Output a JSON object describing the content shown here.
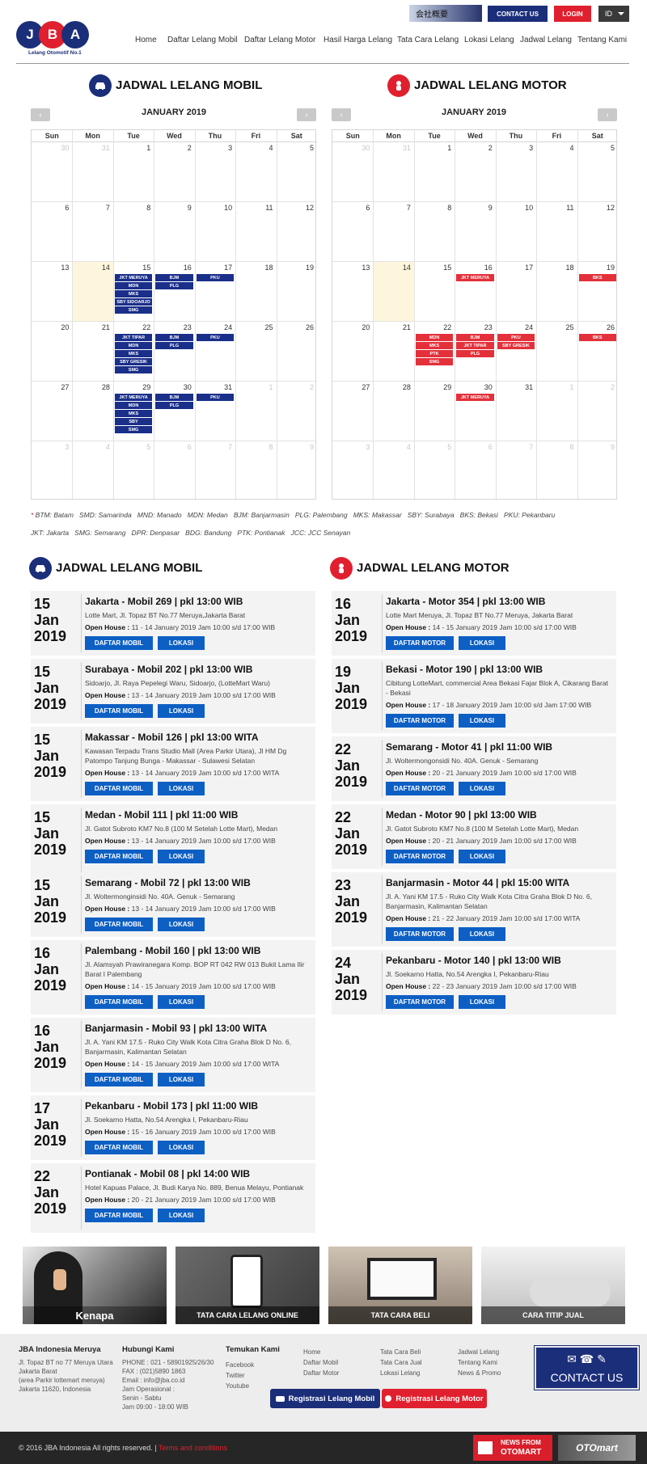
{
  "header": {
    "logo_letters": [
      "J",
      "B",
      "A"
    ],
    "tagline": "Lelang Otomotif No.1",
    "top_banner": "会社概要",
    "contact_btn": "CONTACT US",
    "login_btn": "LOGIN",
    "lang": "ID",
    "nav": [
      "Home",
      "Daftar Lelang Mobil",
      "Daftar Lelang Motor",
      "Hasil Harga Lelang",
      "Tata Cara Lelang",
      "Lokasi Lelang",
      "Jadwal Lelang",
      "Tentang Kami"
    ]
  },
  "calendar_mobil": {
    "title": "JADWAL LELANG MOBIL",
    "month": "JANUARY 2019",
    "days": [
      "Sun",
      "Mon",
      "Tue",
      "Wed",
      "Thu",
      "Fri",
      "Sat"
    ],
    "weeks": [
      [
        "30",
        "31",
        "1",
        "2",
        "3",
        "4",
        "5"
      ],
      [
        "6",
        "7",
        "8",
        "9",
        "10",
        "11",
        "12"
      ],
      [
        "13",
        "14",
        "15",
        "16",
        "17",
        "18",
        "19"
      ],
      [
        "20",
        "21",
        "22",
        "23",
        "24",
        "25",
        "26"
      ],
      [
        "27",
        "28",
        "29",
        "30",
        "31",
        "1",
        "2"
      ],
      [
        "3",
        "4",
        "5",
        "6",
        "7",
        "8",
        "9"
      ]
    ],
    "events": {
      "w2d2": [
        "JKT MERUYA",
        "MDN",
        "MKS",
        "SBY SIDOARJO",
        "SMG"
      ],
      "w2d3": [
        "BJM",
        "PLG"
      ],
      "w2d4": [
        "PKU"
      ],
      "w3d2": [
        "JKT TIPAR",
        "MDN",
        "MKS",
        "SBY GRESIK",
        "SMG"
      ],
      "w3d3": [
        "BJM",
        "PLG"
      ],
      "w3d4": [
        "PKU"
      ],
      "w4d2": [
        "JKT MERUYA",
        "MDN",
        "MKS",
        "SBY",
        "SMG"
      ],
      "w4d3": [
        "BJM",
        "PLG"
      ],
      "w4d4": [
        "PKU"
      ]
    }
  },
  "calendar_motor": {
    "title": "JADWAL LELANG MOTOR",
    "month": "JANUARY 2019",
    "days": [
      "Sun",
      "Mon",
      "Tue",
      "Wed",
      "Thu",
      "Fri",
      "Sat"
    ],
    "weeks": [
      [
        "30",
        "31",
        "1",
        "2",
        "3",
        "4",
        "5"
      ],
      [
        "6",
        "7",
        "8",
        "9",
        "10",
        "11",
        "12"
      ],
      [
        "13",
        "14",
        "15",
        "16",
        "17",
        "18",
        "19"
      ],
      [
        "20",
        "21",
        "22",
        "23",
        "24",
        "25",
        "26"
      ],
      [
        "27",
        "28",
        "29",
        "30",
        "31",
        "1",
        "2"
      ],
      [
        "3",
        "4",
        "5",
        "6",
        "7",
        "8",
        "9"
      ]
    ],
    "events": {
      "w2d3": [
        "JKT MERUYA"
      ],
      "w2d6": [
        "BKS"
      ],
      "w3d2": [
        "MDN",
        "MKS",
        "PTK",
        "SMG"
      ],
      "w3d3": [
        "BJM",
        "JKT TIPAR",
        "PLG"
      ],
      "w3d4": [
        "PKU",
        "SBY GRESIK"
      ],
      "w3d6": [
        "BKS"
      ],
      "w4d3": [
        "JKT MERUYA"
      ]
    }
  },
  "legend": {
    "line1": "BTM: Batam   SMD: Samarinda   MND: Manado   MDN: Medan   BJM: Banjarmasin   PLG: Palembang   MKS: Makassar   SBY: Surabaya   BKS: Bekasi   PKU: Pekanbaru",
    "line2": "JKT: Jakarta   SMG: Semarang   DPR: Denpasar   BDG: Bandung   PTK: Pontianak   JCC: JCC Senayan"
  },
  "list_mobil": {
    "title": "JADWAL LELANG MOBIL",
    "btn1": "DAFTAR MOBIL",
    "btn2": "LOKASI",
    "items": [
      {
        "d": "15",
        "m": "Jan",
        "y": "2019",
        "title": "Jakarta - Mobil 269 | pkl 13:00 WIB",
        "addr": "Lotte Mart, Jl. Topaz BT No.77 Meruya,Jakarta Barat",
        "oh": "11 - 14 January 2019 Jam 10:00 s/d 17:00 WIB"
      },
      {
        "d": "15",
        "m": "Jan",
        "y": "2019",
        "title": "Surabaya - Mobil 202 | pkl 13:00 WIB",
        "addr": "Sidoarjo, Jl. Raya Pepelegi Waru, Sidoarjo, (LotteMart Waru)",
        "oh": "13 - 14 January 2019 Jam 10:00 s/d 17:00 WIB"
      },
      {
        "d": "15",
        "m": "Jan",
        "y": "2019",
        "title": "Makassar - Mobil 126 | pkl 13:00 WITA",
        "addr": "Kawasan Terpadu Trans Studio Mall (Area Parkir Utara), Jl HM Dg Patompo Tanjung Bunga - Makassar - Sulawesi Selatan",
        "oh": "13 - 14 January 2019 Jam 10:00 s/d 17:00 WITA"
      },
      {
        "d": "15",
        "m": "Jan",
        "y": "2019",
        "title": "Medan - Mobil 111 | pkl 11:00 WIB",
        "addr": "Jl. Gatot Subroto KM7 No.8 (100 M Setelah Lotte Mart), Medan",
        "oh": "13 - 14 January 2019 Jam 10:00 s/d 17:00 WIB"
      },
      {
        "d": "15",
        "m": "Jan",
        "y": "2019",
        "title": "Semarang - Mobil 72 | pkl 13:00 WIB",
        "addr": "Jl. Woltermonginsidi No. 40A. Genuk - Semarang",
        "oh": "13 - 14 January 2019 Jam 10:00 s/d 17:00 WIB"
      },
      {
        "d": "16",
        "m": "Jan",
        "y": "2019",
        "title": "Palembang - Mobil 160 | pkl 13:00 WIB",
        "addr": "Jl. Alamsyah Prawiranegara Komp. BOP RT 042 RW 013 Bukit Lama Ilir Barat I Palembang",
        "oh": "14 - 15 January 2019 Jam 10:00 s/d 17:00 WIB"
      },
      {
        "d": "16",
        "m": "Jan",
        "y": "2019",
        "title": "Banjarmasin - Mobil 93 | pkl 13:00 WITA",
        "addr": "Jl. A. Yani KM 17.5 - Ruko City Walk Kota Citra Graha Blok D No. 6, Banjarmasin, Kalimantan Selatan",
        "oh": "14 - 15 January 2019 Jam 10:00 s/d 17:00 WITA"
      },
      {
        "d": "17",
        "m": "Jan",
        "y": "2019",
        "title": "Pekanbaru - Mobil 173 | pkl 11:00 WIB",
        "addr": "Jl. Soekarno Hatta, No.54 Arengka I, Pekanbaru-Riau",
        "oh": "15 - 16 January 2019 Jam 10:00 s/d 17:00 WIB"
      },
      {
        "d": "22",
        "m": "Jan",
        "y": "2019",
        "title": "Pontianak - Mobil 08 | pkl 14:00 WIB",
        "addr": "Hotel Kapuas Palace, Jl. Budi Karya No. 889, Benua Melayu, Pontianak",
        "oh": "20 - 21 January 2019 Jam 10:00 s/d 17:00 WIB"
      }
    ]
  },
  "list_motor": {
    "title": "JADWAL LELANG MOTOR",
    "btn1": "DAFTAR MOTOR",
    "btn2": "LOKASI",
    "items": [
      {
        "d": "16",
        "m": "Jan",
        "y": "2019",
        "title": "Jakarta - Motor 354 | pkl 13:00 WIB",
        "addr": "Lotte Mart Meruya, Jl. Topaz BT No.77 Meruya, Jakarta Barat",
        "oh": "14 - 15 January 2019 Jam 10:00 s/d 17:00 WIB"
      },
      {
        "d": "19",
        "m": "Jan",
        "y": "2019",
        "title": "Bekasi - Motor 190 | pkl 13:00 WIB",
        "addr": "Cibitung LotteMart, commercial Area Bekasi Fajar Blok A, Cikarang Barat - Bekasi",
        "oh": "17 - 18 January 2019 Jam 10:00 s/d Jam 17:00 WIB"
      },
      {
        "d": "22",
        "m": "Jan",
        "y": "2019",
        "title": "Semarang - Motor 41 | pkl 11:00 WIB",
        "addr": "Jl. Woltermongonsidi No. 40A. Genuk - Semarang",
        "oh": "20 - 21 January 2019 Jam 10:00 s/d 17:00 WIB"
      },
      {
        "d": "22",
        "m": "Jan",
        "y": "2019",
        "title": "Medan - Motor 90 | pkl 13:00 WIB",
        "addr": "Jl. Gatot Subroto KM7 No.8 (100 M Setelah Lotte Mart), Medan",
        "oh": "20 - 21 January 2019 Jam 10:00 s/d 17:00 WIB"
      },
      {
        "d": "23",
        "m": "Jan",
        "y": "2019",
        "title": "Banjarmasin - Motor 44 | pkl 15:00 WITA",
        "addr": "Jl. A. Yani KM 17.5 - Ruko City Walk Kota Citra Graha Blok D No. 6, Banjarmasin, Kalimantan Selatan",
        "oh": "21 - 22 January 2019 Jam 10:00 s/d 17:00 WITA"
      },
      {
        "d": "24",
        "m": "Jan",
        "y": "2019",
        "title": "Pekanbaru - Motor 140 | pkl 13:00 WIB",
        "addr": "Jl. Soekarno Hatta, No.54 Arengka I, Pekanbaru-Riau",
        "oh": "22 - 23 January 2019 Jam 10:00 s/d 17:00 WIB"
      }
    ]
  },
  "open_house_label": "Open House :",
  "promos": [
    "Kenapa",
    "TATA CARA LELANG ONLINE",
    "TATA CARA BELI",
    "CARA TITIP JUAL"
  ],
  "footer": {
    "col1_h": "JBA Indonesia Meruya",
    "col1": [
      "Jl. Topaz BT no 77 Meruya Utara",
      "Jakarta Barat",
      "(area Parkir lottemart meruya)",
      "Jakarta 11620, Indonesia"
    ],
    "col2_h": "Hubungi Kami",
    "col2": [
      "PHONE : 021 - 58901925/26/30",
      "FAX : (021)5890 1863",
      "Email : info@jba.co.id",
      "Jam Operasional :",
      "Senin - Sabtu",
      "Jam 09:00 - 18:00 WIB"
    ],
    "col3_h": "Temukan Kami",
    "col3": [
      "Facebook",
      "Twitter",
      "Youtube"
    ],
    "col4": [
      "Home",
      "Daftar Mobil",
      "Daftar Motor"
    ],
    "col5": [
      "Tata Cara Beli",
      "Tata Cara Jual",
      "Lokasi Lelang"
    ],
    "col6": [
      "Jadwal Lelang",
      "Tentang Kami",
      "News & Promo"
    ],
    "contact_big": "CONTACT US",
    "reg_mobil": "Registrasi Lelang Mobil",
    "reg_motor": "Registrasi Lelang Motor",
    "copyright": "© 2016 JBA Indonesia All rights reserved. |",
    "terms": "Terms and conditions",
    "news_from": "NEWS FROM",
    "otomart": "OTOMART",
    "otomart_logo": "OTOmart"
  },
  "colors": {
    "navy": "#1b2e7a",
    "red": "#e0202e",
    "blue": "#0d5fc4"
  }
}
